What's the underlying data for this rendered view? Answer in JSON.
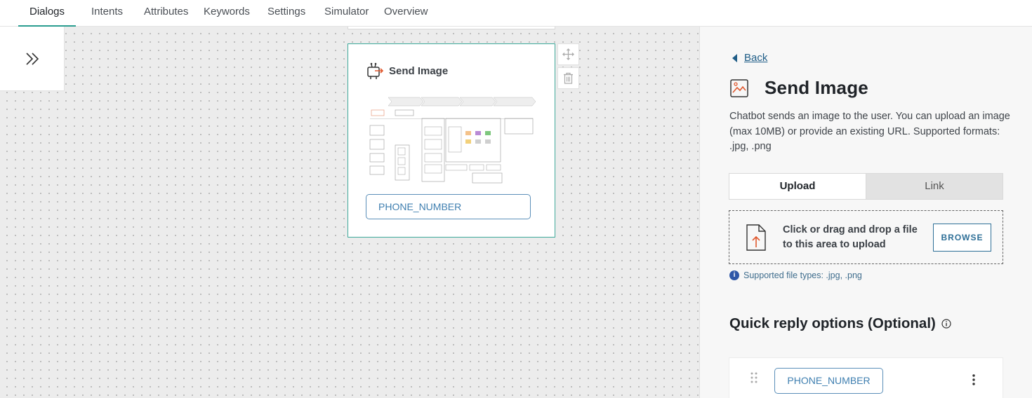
{
  "nav": {
    "tabs": [
      {
        "label": "Dialogs",
        "active": true
      },
      {
        "label": "Intents"
      },
      {
        "label": "Attributes"
      },
      {
        "label": "Keywords"
      },
      {
        "label": "Settings"
      },
      {
        "label": "Simulator"
      },
      {
        "label": "Overview"
      }
    ]
  },
  "canvas": {
    "collapse_icon": "double-chevron-right-icon",
    "node": {
      "icon": "robot-send-icon",
      "title": "Send Image",
      "preview_icon": "diagram-thumbnail",
      "quick_reply": "PHONE_NUMBER"
    },
    "tools": [
      "move-icon",
      "trash-icon"
    ]
  },
  "panel": {
    "back_label": "Back",
    "icon": "image-icon",
    "title": "Send Image",
    "description": "Chatbot sends an image to the user. You can upload an image (max 10MB) or provide an existing URL. Supported formats: .jpg, .png",
    "segments": {
      "upload": "Upload",
      "link": "Link",
      "active": "upload"
    },
    "dropzone": {
      "text": "Click or drag and drop a file to this area to upload",
      "button": "BROWSE",
      "icon": "file-upload-icon"
    },
    "hint": "Supported file types: .jpg, .png",
    "quick_reply_title": "Quick reply options (Optional)",
    "quick_reply_item": "PHONE_NUMBER"
  },
  "colors": {
    "accent": "#2a9d8f",
    "link": "#1f5d87",
    "chip": "#3f7fb0",
    "upload_arrow": "#e0582e"
  }
}
